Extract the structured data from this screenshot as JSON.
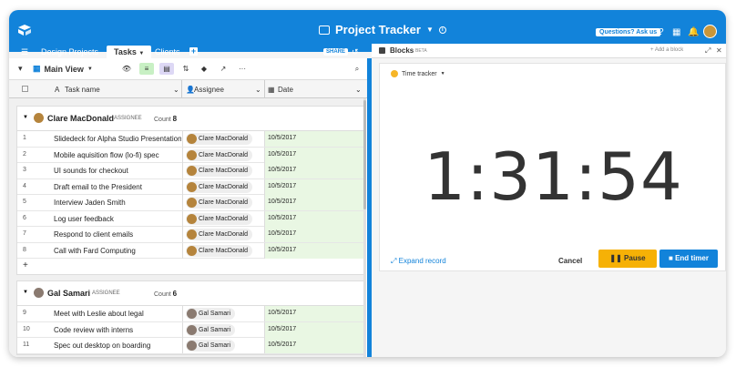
{
  "app": {
    "title": "Project Tracker",
    "help_label": "Questions? Ask us"
  },
  "tabs": [
    {
      "label": "Design Projects"
    },
    {
      "label": "Tasks"
    },
    {
      "label": "Clients"
    }
  ],
  "share_label": "SHARE",
  "toolbar": {
    "view_name": "Main View"
  },
  "columns": {
    "task": "Task name",
    "assignee": "Assignee",
    "date": "Date"
  },
  "groups": [
    {
      "name": "Clare MacDonald",
      "label": "ASSIGNEE",
      "count_label": "Count",
      "count": "8",
      "rows": [
        {
          "num": "1",
          "task": "Slidedeck for Alpha Studio Presentation",
          "assignee": "Clare MacDonald",
          "date": "10/5/2017"
        },
        {
          "num": "2",
          "task": "Mobile aquisition flow (lo-fi) spec",
          "assignee": "Clare MacDonald",
          "date": "10/5/2017"
        },
        {
          "num": "3",
          "task": "UI sounds for checkout",
          "assignee": "Clare MacDonald",
          "date": "10/5/2017"
        },
        {
          "num": "4",
          "task": "Draft email to the President",
          "assignee": "Clare MacDonald",
          "date": "10/5/2017"
        },
        {
          "num": "5",
          "task": "Interview Jaden Smith",
          "assignee": "Clare MacDonald",
          "date": "10/5/2017"
        },
        {
          "num": "6",
          "task": "Log user feedback",
          "assignee": "Clare MacDonald",
          "date": "10/5/2017"
        },
        {
          "num": "7",
          "task": "Respond to client emails",
          "assignee": "Clare MacDonald",
          "date": "10/5/2017"
        },
        {
          "num": "8",
          "task": "Call with Fard Computing",
          "assignee": "Clare MacDonald",
          "date": "10/5/2017"
        }
      ]
    },
    {
      "name": "Gal Samari",
      "label": "ASSIGNEE",
      "count_label": "Count",
      "count": "6",
      "rows": [
        {
          "num": "9",
          "task": "Meet with Leslie about legal",
          "assignee": "Gal Samari",
          "date": "10/5/2017"
        },
        {
          "num": "10",
          "task": "Code review with interns",
          "assignee": "Gal Samari",
          "date": "10/5/2017"
        },
        {
          "num": "11",
          "task": "Spec out desktop on boarding",
          "assignee": "Gal Samari",
          "date": "10/5/2017"
        }
      ]
    }
  ],
  "blocks": {
    "title": "Blocks",
    "beta": "BETA",
    "add_label": "+ Add a block"
  },
  "tracker": {
    "label": "Time tracker",
    "time": "1:31:54",
    "expand_label": "Expand record",
    "cancel_label": "Cancel",
    "pause_label": "Pause",
    "end_label": "End timer"
  },
  "colors": {
    "brand": "#1283da",
    "pause": "#f6b106",
    "date_cell": "#e9f7e3"
  }
}
